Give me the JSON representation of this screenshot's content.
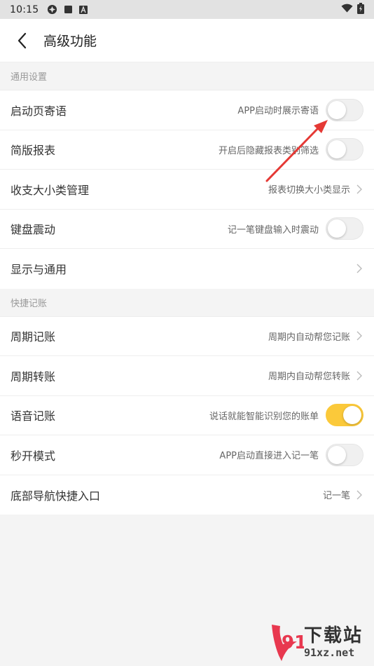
{
  "status_bar": {
    "time": "10:15"
  },
  "app_bar": {
    "title": "高级功能"
  },
  "sections": [
    {
      "header": "通用设置",
      "rows": [
        {
          "label": "启动页寄语",
          "desc": "APP启动时展示寄语",
          "control": "toggle",
          "on": false
        },
        {
          "label": "简版报表",
          "desc": "开启后隐藏报表类别筛选",
          "control": "toggle",
          "on": false
        },
        {
          "label": "收支大小类管理",
          "desc": "报表切换大小类显示",
          "control": "chevron"
        },
        {
          "label": "键盘震动",
          "desc": "记一笔键盘输入时震动",
          "control": "toggle",
          "on": false
        },
        {
          "label": "显示与通用",
          "desc": "",
          "control": "chevron"
        }
      ]
    },
    {
      "header": "快捷记账",
      "rows": [
        {
          "label": "周期记账",
          "desc": "周期内自动帮您记账",
          "control": "chevron"
        },
        {
          "label": "周期转账",
          "desc": "周期内自动帮您转账",
          "control": "chevron"
        },
        {
          "label": "语音记账",
          "desc": "说话就能智能识别您的账单",
          "control": "toggle",
          "on": true
        },
        {
          "label": "秒开模式",
          "desc": "APP启动直接进入记一笔",
          "control": "toggle",
          "on": false
        },
        {
          "label": "底部导航快捷入口",
          "desc": "记一笔",
          "control": "chevron"
        }
      ]
    }
  ],
  "watermark": {
    "main": "下载站",
    "sub": "91xz.net"
  },
  "colors": {
    "toggle_on": "#fbc93a",
    "annotation_arrow": "#e53935"
  }
}
